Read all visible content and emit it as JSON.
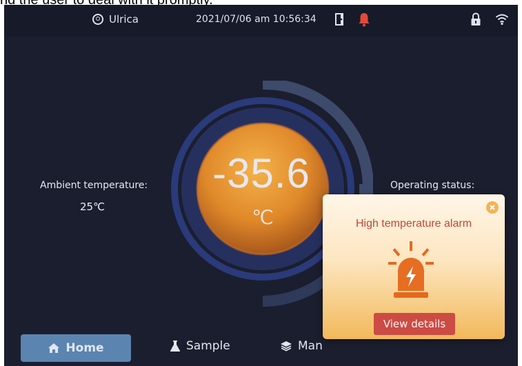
{
  "caption": {
    "text": "nd the user to deal with it promptly."
  },
  "topbar": {
    "user_name": "Ulrica",
    "datetime": "2021/07/06  am  10:56:34",
    "icons": [
      "user-icon",
      "door-icon",
      "bell-icon",
      "lock-icon",
      "wifi-icon"
    ],
    "bell_color": "#e2483c"
  },
  "main": {
    "temperature": {
      "value": "-35.6",
      "unit": "℃"
    },
    "ambient": {
      "label": "Ambient temperature:",
      "value": "25℃"
    },
    "operating": {
      "label": "Operating status:"
    }
  },
  "nav": {
    "home": "Home",
    "sample": "Sample",
    "manage": "Man",
    "active": "home",
    "active_color": "#5b84b0"
  },
  "popup": {
    "title": "High temperature alarm",
    "button": "View details",
    "icon": "siren-lightning-icon",
    "accent": "#cc4b45"
  }
}
